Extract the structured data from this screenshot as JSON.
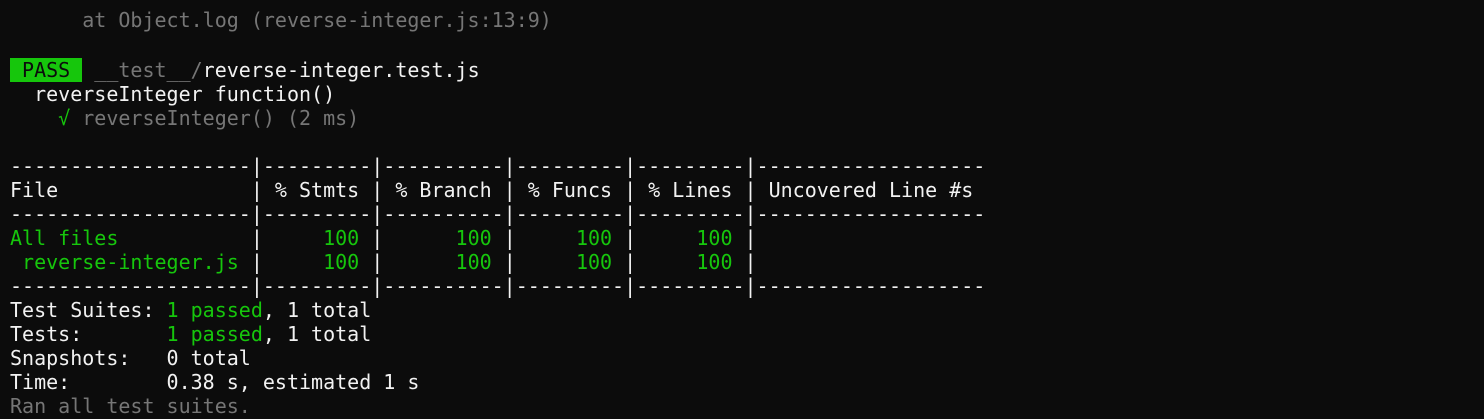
{
  "top_trace": "      at Object.log (reverse-integer.js:13:9)",
  "result": {
    "badge": " PASS ",
    "path_prefix": " __test__/",
    "path_file": "reverse-integer.test.js",
    "describe": "  reverseInteger function()",
    "check_mark": "    √",
    "test_name": " reverseInteger() (2 ms)"
  },
  "coverage": {
    "separator": "--------------------|---------|----------|---------|---------|-------------------",
    "header": "File                | % Stmts | % Branch | % Funcs | % Lines | Uncovered Line #s ",
    "rows": [
      {
        "name": "All files          ",
        "sep1": " | ",
        "stmts": "    100",
        "sep2": " | ",
        "branch": "     100",
        "sep3": " | ",
        "funcs": "    100",
        "sep4": " | ",
        "lines": "    100",
        "sep5": " | "
      },
      {
        "name": " reverse-integer.js",
        "sep1": " | ",
        "stmts": "    100",
        "sep2": " | ",
        "branch": "     100",
        "sep3": " | ",
        "funcs": "    100",
        "sep4": " | ",
        "lines": "    100",
        "sep5": " | "
      }
    ]
  },
  "summary": {
    "suites_label": "Test Suites: ",
    "suites_passed": "1 passed",
    "suites_total": ", 1 total",
    "tests_label": "Tests:       ",
    "tests_passed": "1 passed",
    "tests_total": ", 1 total",
    "snapshots": "Snapshots:   0 total",
    "time": "Time:        0.38 s, estimated 1 s",
    "ran": "Ran all test suites."
  },
  "colors": {
    "background": "#0c0c0c",
    "text": "#cccccc",
    "dim": "#767676",
    "green": "#16c60c"
  }
}
